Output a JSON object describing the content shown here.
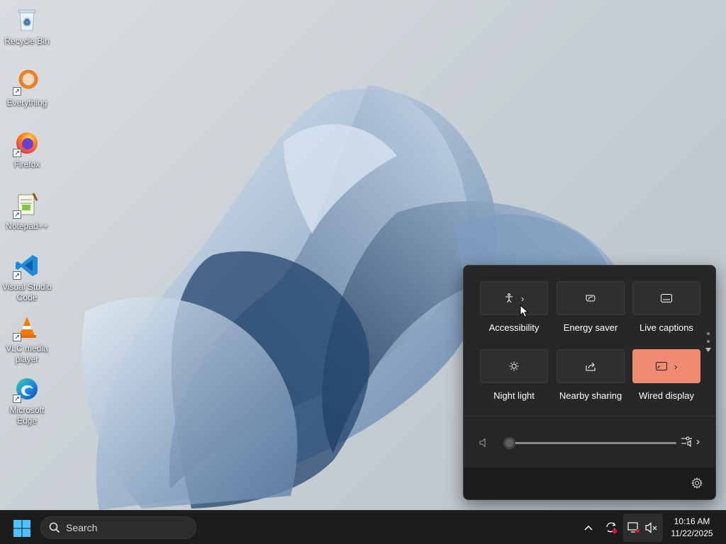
{
  "desktop": {
    "icons": [
      {
        "label": "Recycle Bin",
        "icon": "recycle-bin-icon"
      },
      {
        "label": "Everything",
        "icon": "everything-icon"
      },
      {
        "label": "Firefox",
        "icon": "firefox-icon"
      },
      {
        "label": "Notepad++",
        "icon": "notepadpp-icon"
      },
      {
        "label": "Visual Studio Code",
        "icon": "vscode-icon"
      },
      {
        "label": "VLC media player",
        "icon": "vlc-icon"
      },
      {
        "label": "Microsoft Edge",
        "icon": "edge-icon"
      }
    ]
  },
  "quick_settings": {
    "tiles": [
      {
        "label": "Accessibility",
        "icon": "accessibility-icon",
        "active": false,
        "has_chevron": true
      },
      {
        "label": "Energy saver",
        "icon": "energy-saver-icon",
        "active": false,
        "has_chevron": false
      },
      {
        "label": "Live captions",
        "icon": "live-captions-icon",
        "active": false,
        "has_chevron": false
      },
      {
        "label": "Night light",
        "icon": "night-light-icon",
        "active": false,
        "has_chevron": false
      },
      {
        "label": "Nearby sharing",
        "icon": "nearby-sharing-icon",
        "active": false,
        "has_chevron": false
      },
      {
        "label": "Wired display",
        "icon": "wired-display-icon",
        "active": true,
        "has_chevron": true
      }
    ],
    "volume_level": 0,
    "accent_color": "#f08a73"
  },
  "taskbar": {
    "search_placeholder": "Search",
    "clock": {
      "time": "10:16 AM",
      "date": "11/22/2025"
    }
  }
}
